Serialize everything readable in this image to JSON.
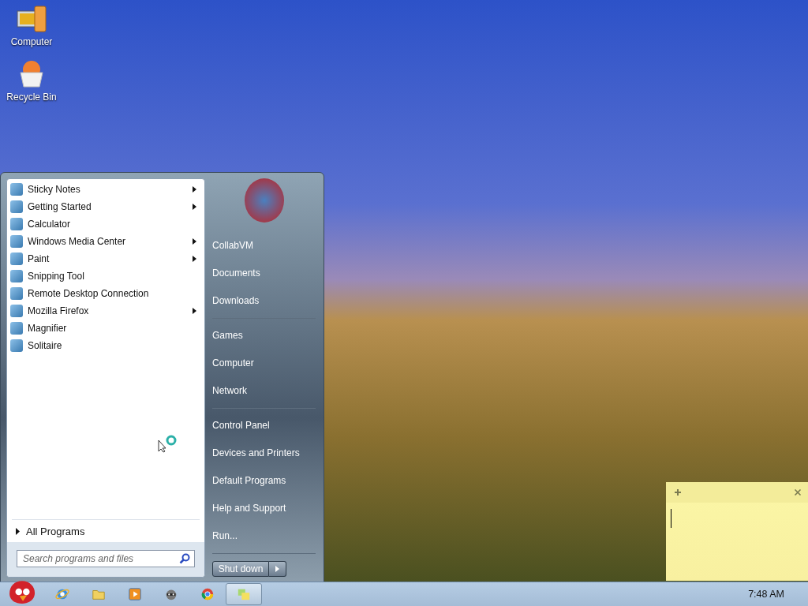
{
  "desktop_icons": [
    {
      "label": "Computer",
      "kind": "computer"
    },
    {
      "label": "Recycle Bin",
      "kind": "bin"
    }
  ],
  "start_menu": {
    "programs": [
      {
        "label": "Sticky Notes",
        "has_submenu": true
      },
      {
        "label": "Getting Started",
        "has_submenu": true
      },
      {
        "label": "Calculator",
        "has_submenu": false
      },
      {
        "label": "Windows Media Center",
        "has_submenu": true
      },
      {
        "label": "Paint",
        "has_submenu": true
      },
      {
        "label": "Snipping Tool",
        "has_submenu": false
      },
      {
        "label": "Remote Desktop Connection",
        "has_submenu": false
      },
      {
        "label": "Mozilla Firefox",
        "has_submenu": true
      },
      {
        "label": "Magnifier",
        "has_submenu": false
      },
      {
        "label": "Solitaire",
        "has_submenu": false
      }
    ],
    "all_programs": "All Programs",
    "search": {
      "placeholder": "Search programs and files"
    },
    "place_groups": [
      [
        "CollabVM",
        "Documents",
        "Downloads"
      ],
      [
        "Games",
        "Computer",
        "Network"
      ],
      [
        "Control Panel",
        "Devices and Printers",
        "Default Programs",
        "Help and Support",
        "Run..."
      ]
    ],
    "shutdown": "Shut down"
  },
  "taskbar": {
    "buttons": [
      {
        "kind": "start",
        "selected": false
      },
      {
        "kind": "browser",
        "selected": false
      },
      {
        "kind": "folder",
        "selected": false
      },
      {
        "kind": "media",
        "selected": false
      },
      {
        "kind": "raccoon",
        "selected": false
      },
      {
        "kind": "chrome",
        "selected": false
      },
      {
        "kind": "notes",
        "selected": true
      }
    ],
    "clock": "7:48 AM"
  }
}
